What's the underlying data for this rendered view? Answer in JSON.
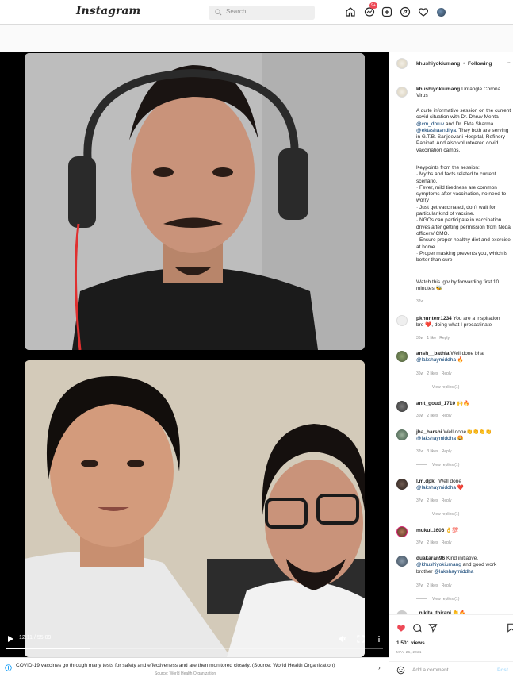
{
  "header": {
    "logo": "Instagram",
    "search_placeholder": "Search",
    "messages_badge": "9+"
  },
  "video": {
    "time": "12:11 / 55:09",
    "progress": 0.22
  },
  "banner": {
    "text": "COVID-19 vaccines go through many tests for safety and effectiveness and are then monitored closely. (Source: World Health Organization)",
    "source": "Source: World Health Organization"
  },
  "sidebar": {
    "owner": "khushiyokiumang",
    "follow_sep": "•",
    "follow_status": "Following",
    "caption": {
      "title": "Untangle Corona Virus",
      "p1_a": "A quite informative session on the current covid situation with Dr. Dhruv Mehta ",
      "mention1": "@cm_dhruv",
      "p1_b": " and Dr. Ekta Sharma ",
      "mention2": "@ektashaandilya",
      "p1_c": ". They both are serving in G.T.B. Sanjeevani Hospital, Refinery Panipat. And also volunteered covid vaccination camps.",
      "p2_head": "Keypoints from the session:",
      "points": [
        "· Myths and facts related to current scenario.",
        "· Fever, mild tiredness are common symptoms after vaccination, no need to worry",
        "· Just get vaccinated, don't wait for particular kind of vaccine.",
        "· NGOs can participate in vaccination drives after getting permission from Nodal officers/ CMO.",
        "· Ensure proper healthy diet and exercise at home.",
        "· Proper masking prevents you, which is better than cure"
      ],
      "p3": "Watch this igtv by forwarding first 10 minutes 🐝",
      "age": "37w"
    },
    "comments": [
      {
        "user": "pkhunterr1234",
        "text": "You are a inspiration bro ❤️, doing what I procastinate",
        "age": "36w",
        "likes": "1 like",
        "reply": "Reply"
      },
      {
        "user": "ansh__bathla",
        "text": "Well done bhai",
        "mention": "@lakshaymiddha",
        "emoji": "🔥",
        "age": "36w",
        "likes": "2 likes",
        "reply": "Reply",
        "view_replies": "View replies (1)"
      },
      {
        "user": "anit_goud_1710",
        "text": "🙌🔥",
        "age": "36w",
        "likes": "2 likes",
        "reply": "Reply"
      },
      {
        "user": "jha_harshi",
        "text": "Well done👏👏👏👏",
        "mention": "@lakshaymiddha",
        "emoji": "🤩",
        "age": "37w",
        "likes": "3 likes",
        "reply": "Reply",
        "view_replies": "View replies (1)"
      },
      {
        "user": "l.m.dpk_",
        "text": "Well done",
        "mention": "@lakshaymiddha",
        "emoji": "❤️",
        "age": "37w",
        "likes": "2 likes",
        "reply": "Reply",
        "view_replies": "View replies (1)"
      },
      {
        "user": "mukul.1606",
        "text": "👌💯",
        "age": "37w",
        "likes": "2 likes",
        "reply": "Reply"
      },
      {
        "user": "duakaran96",
        "text": "Kind initiative,",
        "mention": "@khushiyokiumang",
        "text2": "and good work brother",
        "mention2": "@lakshaymiddha",
        "age": "37w",
        "likes": "2 likes",
        "reply": "Reply",
        "view_replies": "View replies (1)"
      }
    ],
    "partial_comment": "_nikita_thirani 👏🔥",
    "views": "1,501 views",
    "date": "MAY 26, 2021",
    "add_comment_placeholder": "Add a comment...",
    "post_label": "Post"
  },
  "colors": {
    "like_red": "#ed4956",
    "link_blue": "#00376b",
    "post_disabled": "#b2dffc"
  }
}
